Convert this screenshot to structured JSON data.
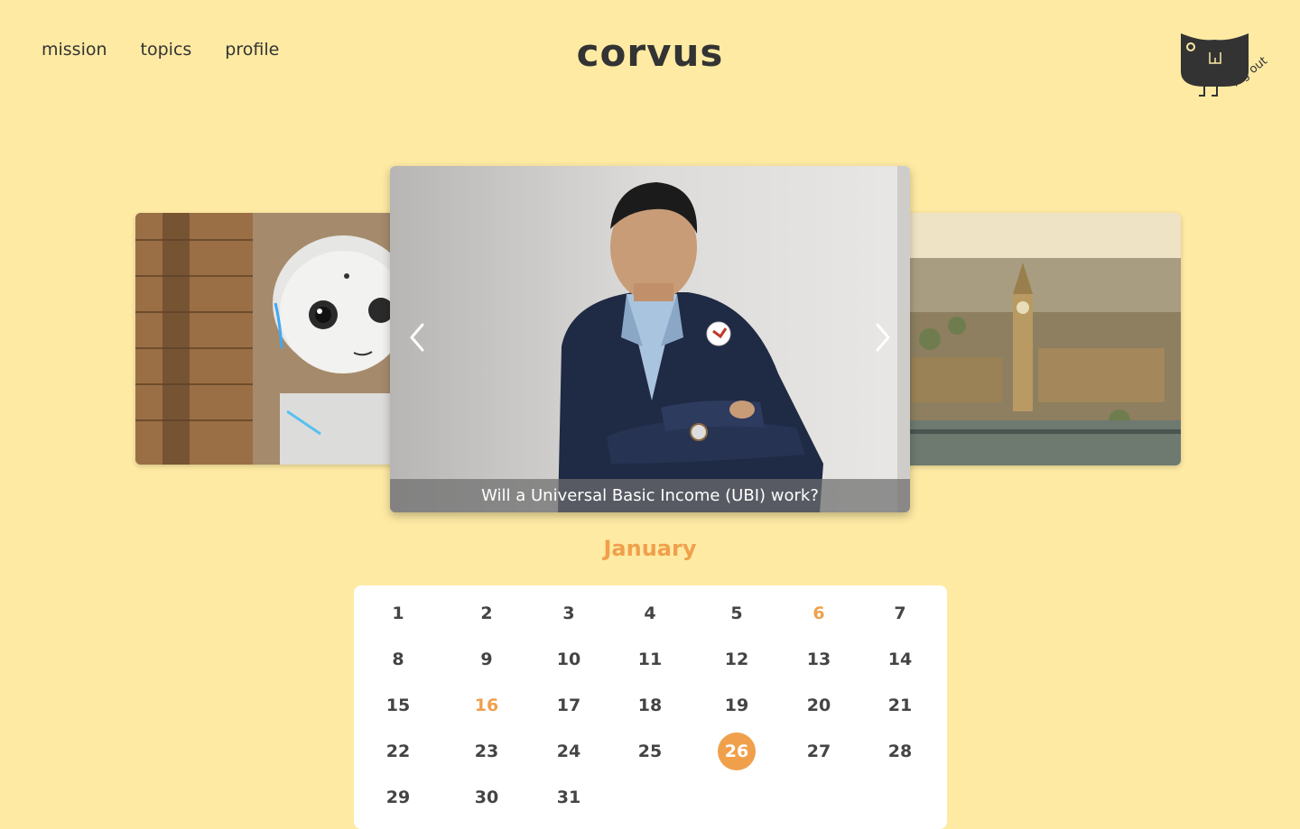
{
  "nav": {
    "items": [
      {
        "label": "mission"
      },
      {
        "label": "topics"
      },
      {
        "label": "profile"
      }
    ]
  },
  "brand": {
    "logo": "corvus"
  },
  "account": {
    "logout_label": "log out",
    "mascot_icon": "crow-mascot-icon"
  },
  "carousel": {
    "slides": [
      {
        "image": "robot-photo"
      },
      {
        "image": "portrait-photo",
        "caption": "Will a Universal Basic Income (UBI) work?"
      },
      {
        "image": "london-cityscape-photo"
      }
    ],
    "prev_icon": "chevron-left-icon",
    "next_icon": "chevron-right-icon"
  },
  "calendar": {
    "month": "January",
    "days": [
      "1",
      "2",
      "3",
      "4",
      "5",
      "6",
      "7",
      "8",
      "9",
      "10",
      "11",
      "12",
      "13",
      "14",
      "15",
      "16",
      "17",
      "18",
      "19",
      "20",
      "21",
      "22",
      "23",
      "24",
      "25",
      "26",
      "27",
      "28",
      "29",
      "30",
      "31"
    ],
    "highlighted_days": [
      "6",
      "16"
    ],
    "selected_day": "26"
  },
  "colors": {
    "background": "#FEEAA3",
    "accent": "#F0A04B",
    "text": "#333333"
  }
}
